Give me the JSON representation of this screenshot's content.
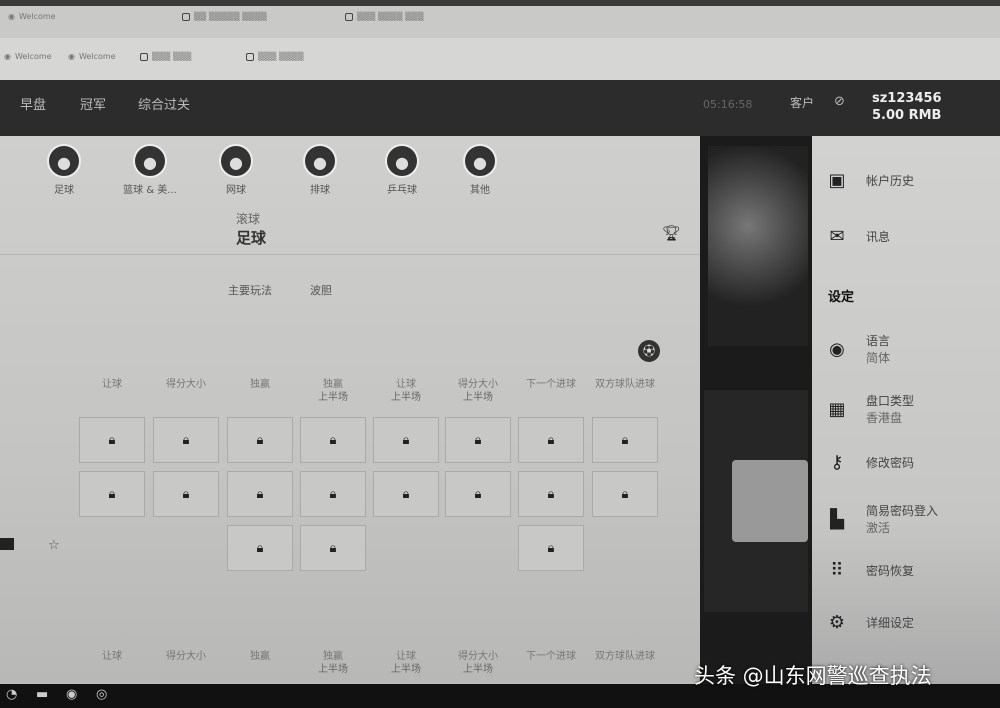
{
  "browser": {
    "tabs_row1": [
      "Welcome",
      "",
      ""
    ],
    "tabs_row2": [
      "Welcome",
      "Welcome",
      "",
      ""
    ]
  },
  "header": {
    "nav": [
      "早盘",
      "冠军",
      "综合过关"
    ],
    "time": "05:16:58",
    "client": "客户",
    "username": "sz123456",
    "balance": "5.00 RMB"
  },
  "sports": [
    {
      "label": "足球",
      "icon": "soccer-icon"
    },
    {
      "label": "篮球 & 美...",
      "icon": "basketball-icon"
    },
    {
      "label": "网球",
      "icon": "tennis-icon"
    },
    {
      "label": "排球",
      "icon": "volleyball-icon"
    },
    {
      "label": "乒乓球",
      "icon": "table-tennis-icon"
    },
    {
      "label": "其他",
      "icon": "other-icon"
    }
  ],
  "section": {
    "live": "滚球",
    "sport": "足球"
  },
  "market_tabs": [
    "主要玩法",
    "波胆"
  ],
  "columns": [
    [
      "让球",
      ""
    ],
    [
      "得分大小",
      ""
    ],
    [
      "独赢",
      ""
    ],
    [
      "独赢",
      "上半场"
    ],
    [
      "让球",
      "上半场"
    ],
    [
      "得分大小",
      "上半场"
    ],
    [
      "下一个进球",
      ""
    ],
    [
      "双方球队进球",
      ""
    ]
  ],
  "rows": [
    [
      1,
      1,
      1,
      1,
      1,
      1,
      1,
      1
    ],
    [
      1,
      1,
      1,
      1,
      1,
      1,
      1,
      1
    ],
    [
      0,
      0,
      1,
      1,
      0,
      0,
      1,
      0
    ]
  ],
  "sidebar": {
    "items": [
      {
        "label": "帐户历史",
        "icon": "history-icon"
      },
      {
        "label": "讯息",
        "icon": "mail-icon"
      }
    ],
    "settings_title": "设定",
    "settings": [
      {
        "label": "语言",
        "value": "简体",
        "icon": "globe-icon"
      },
      {
        "label": "盘口类型",
        "value": "香港盘",
        "icon": "grid-icon"
      },
      {
        "label": "修改密码",
        "value": "",
        "icon": "key-icon"
      },
      {
        "label": "简易密码登入",
        "value": "激活",
        "icon": "pin-icon"
      },
      {
        "label": "密码恢复",
        "value": "",
        "icon": "keypad-icon"
      },
      {
        "label": "详细设定",
        "value": "",
        "icon": "settings-icon"
      }
    ]
  },
  "watermark": "头条 @山东网警巡查执法"
}
